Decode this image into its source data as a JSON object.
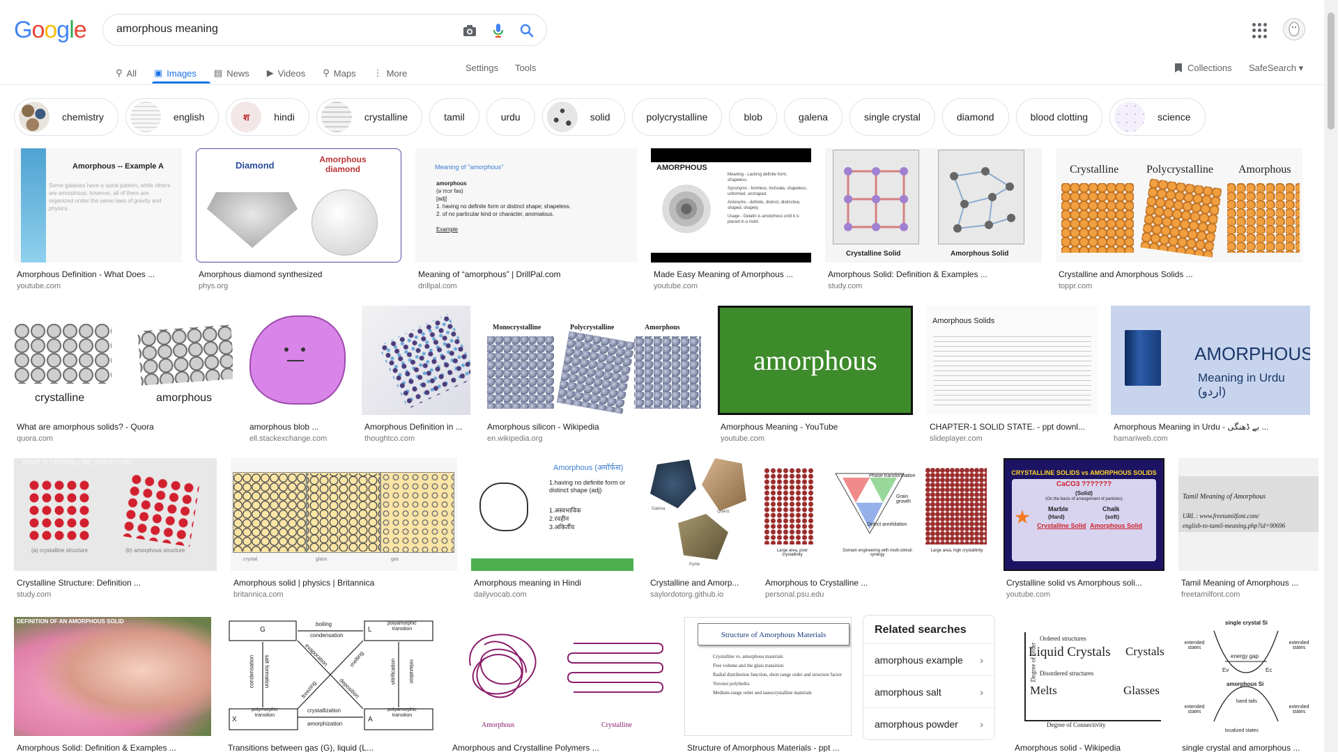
{
  "logo": {
    "text": "Google",
    "letters": [
      "G",
      "o",
      "o",
      "g",
      "l",
      "e"
    ],
    "colors": [
      "#4285F4",
      "#EA4335",
      "#FBBC05",
      "#4285F4",
      "#34A853",
      "#EA4335"
    ]
  },
  "search": {
    "query": "amorphous meaning",
    "icons": [
      "camera-icon",
      "mic-icon",
      "search-icon"
    ]
  },
  "tabs": [
    {
      "label": "All",
      "icon": "search-icon",
      "active": false
    },
    {
      "label": "Images",
      "icon": "image-icon",
      "active": true
    },
    {
      "label": "News",
      "icon": "news-icon",
      "active": false
    },
    {
      "label": "Videos",
      "icon": "video-icon",
      "active": false
    },
    {
      "label": "Maps",
      "icon": "map-icon",
      "active": false
    },
    {
      "label": "More",
      "icon": "more-icon",
      "active": false
    }
  ],
  "tools": {
    "settings": "Settings",
    "tools": "Tools",
    "collections": "Collections",
    "safesearch": "SafeSearch"
  },
  "chips": [
    {
      "label": "chemistry",
      "thumb": true
    },
    {
      "label": "english",
      "thumb": true
    },
    {
      "label": "hindi",
      "thumb": true
    },
    {
      "label": "crystalline",
      "thumb": true
    },
    {
      "label": "tamil",
      "thumb": false
    },
    {
      "label": "urdu",
      "thumb": false
    },
    {
      "label": "solid",
      "thumb": true
    },
    {
      "label": "polycrystalline",
      "thumb": false
    },
    {
      "label": "blob",
      "thumb": false
    },
    {
      "label": "galena",
      "thumb": false
    },
    {
      "label": "single crystal",
      "thumb": false
    },
    {
      "label": "diamond",
      "thumb": false
    },
    {
      "label": "blood clotting",
      "thumb": false
    },
    {
      "label": "science",
      "thumb": true
    }
  ],
  "rows": [
    [
      {
        "caption": "Amorphous Definition - What Does ...",
        "source": "youtube.com",
        "img_title": "Amorphous -- Example A",
        "img_text": "Some galaxies have a spiral pattern, while others are amorphous; however, all of them are organized under the same laws of gravity and physics."
      },
      {
        "caption": "Amorphous diamond synthesized",
        "source": "phys.org",
        "img_labels": [
          "Diamond",
          "Amorphous diamond"
        ]
      },
      {
        "caption": "Meaning of “amorphous” | DrillPal.com",
        "source": "drillpal.com",
        "img_title": "Meaning of \"amorphous\"",
        "img_lines": [
          "amorphous",
          "(əˈmɔr fəs)",
          "[adj]",
          "1. having no definite form or distinct shape; shapeless.",
          "2. of no particular kind or character, anomalous.",
          "Example"
        ]
      },
      {
        "caption": "Made Easy Meaning of Amorphous ...",
        "source": "youtube.com",
        "img_title": "AMORPHOUS",
        "img_lines": [
          "Meaning - Lacking definite form; shapeless.",
          "Synonyms - formless, inchoate, shapeless, unformed, unshaped.",
          "Antonyms - definite, distinct, distinctive, shaped, shapely.",
          "Usage - Gelatin is amorphous until it is placed in a mold."
        ]
      },
      {
        "caption": "Amorphous Solid: Definition & Examples ...",
        "source": "study.com",
        "img_labels": [
          "Crystalline Solid",
          "Amorphous Solid"
        ]
      },
      {
        "caption": "Crystalline and Amorphous Solids ...",
        "source": "toppr.com",
        "img_labels": [
          "Crystalline",
          "Polycrystalline",
          "Amorphous"
        ]
      }
    ],
    [
      {
        "caption": "What are amorphous solids? - Quora",
        "source": "quora.com",
        "img_labels": [
          "crystalline",
          "amorphous"
        ]
      },
      {
        "caption": "amorphous blob ...",
        "source": "ell.stackexchange.com"
      },
      {
        "caption": "Amorphous Definition in ...",
        "source": "thoughtco.com"
      },
      {
        "caption": "Amorphous silicon - Wikipedia",
        "source": "en.wikipedia.org",
        "img_labels": [
          "Monocrystalline",
          "Polycrystalline",
          "Amorphous"
        ]
      },
      {
        "caption": "Amorphous Meaning - YouTube",
        "source": "youtube.com",
        "img_title": "amorphous"
      },
      {
        "caption": "CHAPTER-1 SOLID STATE. - ppt downl...",
        "source": "slideplayer.com",
        "img_title": "Amorphous Solids"
      },
      {
        "caption": "Amorphous Meaning in Urdu - بے ڈھنگی ...",
        "source": "hamariweb.com",
        "img_title": "AMORPHOUS",
        "img_sub": "Meaning in Urdu (اردو)"
      }
    ],
    [
      {
        "caption": "Crystalline Structure: Definition ...",
        "source": "study.com",
        "img_title": "WHAT IS CRYSTALLINE STRUCTURE",
        "img_labels": [
          "(a) crystalline structure",
          "(b) amorphous structure"
        ]
      },
      {
        "caption": "Amorphous solid | physics | Britannica",
        "source": "britannica.com",
        "img_labels": [
          "crystal",
          "glass",
          "gas"
        ]
      },
      {
        "caption": "Amorphous meaning in Hindi",
        "source": "dailyvocab.com",
        "img_title": "Amorphous (अमॉर्फस)",
        "img_lines": [
          "1.having no definite form or distinct shape (adj)",
          "1.अस्वभाविक",
          "2.रवहीन",
          "3.अकिर्तीय"
        ]
      },
      {
        "caption": "Crystalline and Amorp...",
        "source": "saylordotorg.github.io",
        "img_labels": [
          "Galena",
          "Quartz",
          "Pyrite"
        ]
      },
      {
        "caption": "Amorphous to Crystalline ...",
        "source": "personal.psu.edu",
        "img_labels": [
          "Phase transformation",
          "Grain growth",
          "Defect annihilation",
          "Large area, poor crystallinity",
          "Domain engineering with multi-stimuli synergy",
          "Large area, high crystallinity"
        ]
      },
      {
        "caption": "Crystalline solid vs Amorphous soli...",
        "source": "youtube.com",
        "img_title": "CRYSTALLINE SOLIDS vs AMORPHOUS SOLIDS",
        "img_lines": [
          "CaCO3 ???????",
          "(Solid)",
          "(On the basis of arrangement of particles)",
          "Marble",
          "Chalk",
          "(Hard)",
          "(soft)",
          "Crystalline Solid",
          "Amorphous Solid"
        ]
      },
      {
        "caption": "Tamil Meaning of Amorphous ...",
        "source": "freetamilfont.com",
        "img_title": "Tamil Meaning of Amorphous",
        "img_lines": [
          "URL : www.freetamilfont.com/",
          "english-to-tamil-meaning.php?id=90696"
        ]
      }
    ],
    [
      {
        "caption": "Amorphous Solid: Definition & Examples ...",
        "source": "study.com",
        "img_title": "DEFINITION OF AN AMORPHOUS SOLID"
      },
      {
        "caption": "Transitions between gas (G), liquid (L...",
        "source": "",
        "img_labels": [
          "G",
          "L",
          "X",
          "A",
          "boiling",
          "condensation",
          "polyamorphic transition",
          "evaporation",
          "melting",
          "freezing",
          "deposition",
          "salt formation",
          "condensation",
          "vitrification",
          "relaxation",
          "polymorphic transition",
          "crystallization",
          "amorphization",
          "polyamorphic transition"
        ]
      },
      {
        "caption": "Amorphous and Crystalline Polymers ...",
        "source": "",
        "img_labels": [
          "Amorphous",
          "Crystalline"
        ]
      },
      {
        "caption": "Structure of Amorphous Materials - ppt ...",
        "source": "",
        "img_title": "Structure of Amorphous Materials",
        "img_lines": [
          "Crystalline vs. amorphous materials",
          "Free volume and the glass transition",
          "Radial distribution function, short range order and structure factor",
          "Voronoi polyhedra",
          "Medium-range order and nanocrystalline materials"
        ]
      },
      {
        "caption": "Amorphous solid - Wikipedia",
        "source": "",
        "img_labels": [
          "Ordered structures",
          "Liquid Crystals",
          "Crystals",
          "Disordered structures",
          "Melts",
          "Glasses",
          "Degree of order",
          "Degree of Connectivity"
        ]
      },
      {
        "caption": "single crystal and amorphous ...",
        "source": "",
        "img_labels": [
          "single crystal Si",
          "extended states",
          "energy gap",
          "extended states",
          "Ev",
          "Ec",
          "amorphous Si",
          "band tails",
          "extended states",
          "extended states",
          "localized states"
        ]
      }
    ]
  ],
  "related": {
    "title": "Related searches",
    "items": [
      "amorphous example",
      "amorphous salt",
      "amorphous powder"
    ]
  },
  "colors": {
    "accent": "#1a73e8",
    "text": "#202124",
    "muted": "#70757a"
  }
}
